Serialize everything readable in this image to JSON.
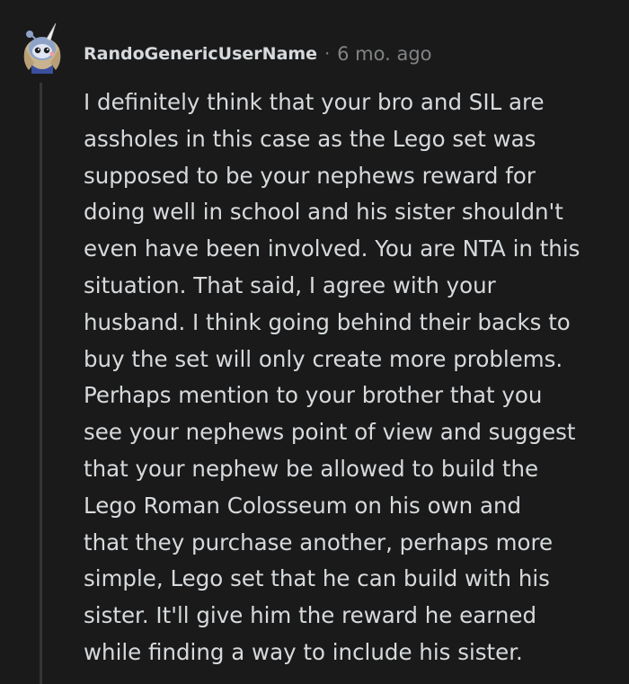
{
  "comment": {
    "username": "RandoGenericUserName",
    "separator": "·",
    "timestamp": "6 mo. ago",
    "avatar_icon": "snoo-unicorn-avatar-icon",
    "body_lines": [
      "I definitely think that your bro and SIL are",
      "assholes in this case as the Lego set was",
      "supposed to be your nephews reward for",
      "doing well in school and his sister shouldn't",
      "even have been involved. You are NTA in this",
      "situation. That said, I agree with your",
      "husband. I think going behind their backs to",
      "buy the set will only create more problems.",
      "Perhaps mention to your brother that you",
      "see your nephews point of view and suggest",
      "that your nephew be allowed to build the",
      "Lego Roman Colosseum on his own and",
      "that they purchase another, perhaps more",
      "simple, Lego set that he can build with his",
      "sister. It'll give him the reward he earned",
      "while finding a way to include his sister."
    ]
  },
  "colors": {
    "background": "#1a1a1b",
    "text": "#d7dadc",
    "meta": "#818384",
    "thread_line": "#343536"
  }
}
